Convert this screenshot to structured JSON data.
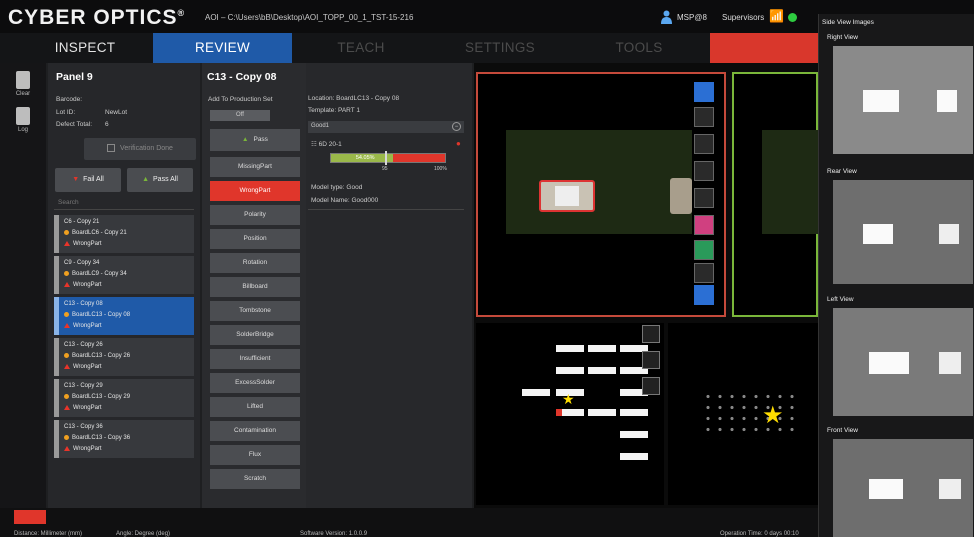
{
  "app": {
    "logo": "CYBER OPTICS",
    "logo_mark": "®",
    "title": "AOI – C:\\Users\\bB\\Desktop\\AOI_TOPP_00_1_TST-15-216",
    "user": "MSP@8",
    "role": "Supervisors"
  },
  "nav": {
    "tabs": [
      "INSPECT",
      "REVIEW",
      "TEACH",
      "SETTINGS",
      "TOOLS"
    ],
    "active": "REVIEW"
  },
  "toolstrip": {
    "clear": "Clear",
    "log": "Log"
  },
  "panel": {
    "title": "Panel 9",
    "barcode_label": "Barcode:",
    "lot_label": "Lot ID:",
    "lot_value": "NewLot",
    "defect_label": "Defect Total:",
    "defect_value": "6",
    "verification_button": "Verification Done",
    "fail_all": "Fail All",
    "pass_all": "Pass All",
    "search_placeholder": "Search",
    "items": [
      {
        "title": "C6 - Copy 21",
        "board": "BoardLC6 - Copy 21",
        "defect": "WrongPart"
      },
      {
        "title": "C9 - Copy 34",
        "board": "BoardLC9 - Copy 34",
        "defect": "WrongPart"
      },
      {
        "title": "C13 - Copy 08",
        "board": "BoardLC13 - Copy 08",
        "defect": "WrongPart"
      },
      {
        "title": "C13 - Copy 26",
        "board": "BoardLC13 - Copy 26",
        "defect": "WrongPart"
      },
      {
        "title": "C13 - Copy 29",
        "board": "BoardLC13 - Copy 29",
        "defect": "WrongPart"
      },
      {
        "title": "C13 - Copy 36",
        "board": "BoardLC13 - Copy 36",
        "defect": "WrongPart"
      }
    ]
  },
  "defect": {
    "title": "C13 - Copy 08",
    "add_label": "Add To Production Set",
    "toggle": "Off",
    "pass": "Pass",
    "buttons": [
      "MissingPart",
      "WrongPart",
      "Polarity",
      "Position",
      "Rotation",
      "Billboard",
      "Tombstone",
      "SolderBridge",
      "Insufficient",
      "ExcessSolder",
      "Lifted",
      "Contamination",
      "Flux",
      "Scratch"
    ],
    "selected": "WrongPart"
  },
  "info": {
    "location": "Location: BoardLC13 - Copy 08",
    "template": "Template: PART 1",
    "section": "Good1",
    "item": "6D 20-1",
    "progress_value": 54.05,
    "progress_text": "54.05%",
    "tick_mid": "95",
    "tick_end": "100%",
    "model_type": "Model type: Good",
    "model_name": "Model Name: Good000"
  },
  "side": {
    "title": "Side View Images",
    "views": [
      "Right View",
      "Rear View",
      "Left View",
      "Front View"
    ]
  },
  "status": {
    "distance": "Distance: Millimeter (mm)",
    "angle": "Angle: Degree (deg)",
    "version": "Software Version: 1.0.0.9",
    "operation": "Operation Time: 0 days 00:10"
  },
  "colors": {
    "accent": "#1f5aa8",
    "alert": "#e0362b",
    "ok": "#7ab63a"
  }
}
